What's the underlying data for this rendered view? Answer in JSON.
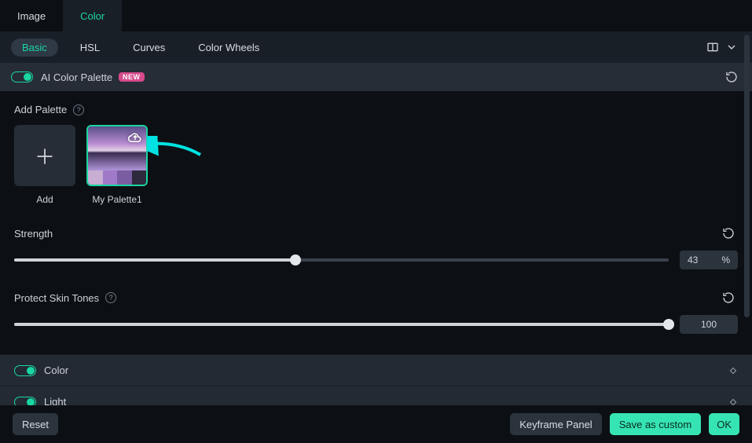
{
  "accent": "#1ad6a0",
  "mainTabs": {
    "image": "Image",
    "color": "Color",
    "active": "color"
  },
  "subTabs": {
    "basic": "Basic",
    "hsl": "HSL",
    "curves": "Curves",
    "wheels": "Color Wheels",
    "active": "basic"
  },
  "aiRow": {
    "label": "AI Color Palette",
    "badge": "NEW",
    "enabled": true
  },
  "palette": {
    "heading": "Add Palette",
    "addLabel": "Add",
    "items": [
      {
        "label": "My Palette1",
        "selected": true,
        "swatches": [
          "#c7aed2",
          "#a079c8",
          "#7a5ca3",
          "#2e2a3d"
        ]
      }
    ]
  },
  "strength": {
    "label": "Strength",
    "value": 43,
    "unit": "%",
    "max": 100
  },
  "protect": {
    "label": "Protect Skin Tones",
    "value": 100,
    "max": 100
  },
  "sections": {
    "color": "Color",
    "light": "Light"
  },
  "footer": {
    "reset": "Reset",
    "keyframe": "Keyframe Panel",
    "save": "Save as custom",
    "ok": "OK"
  }
}
